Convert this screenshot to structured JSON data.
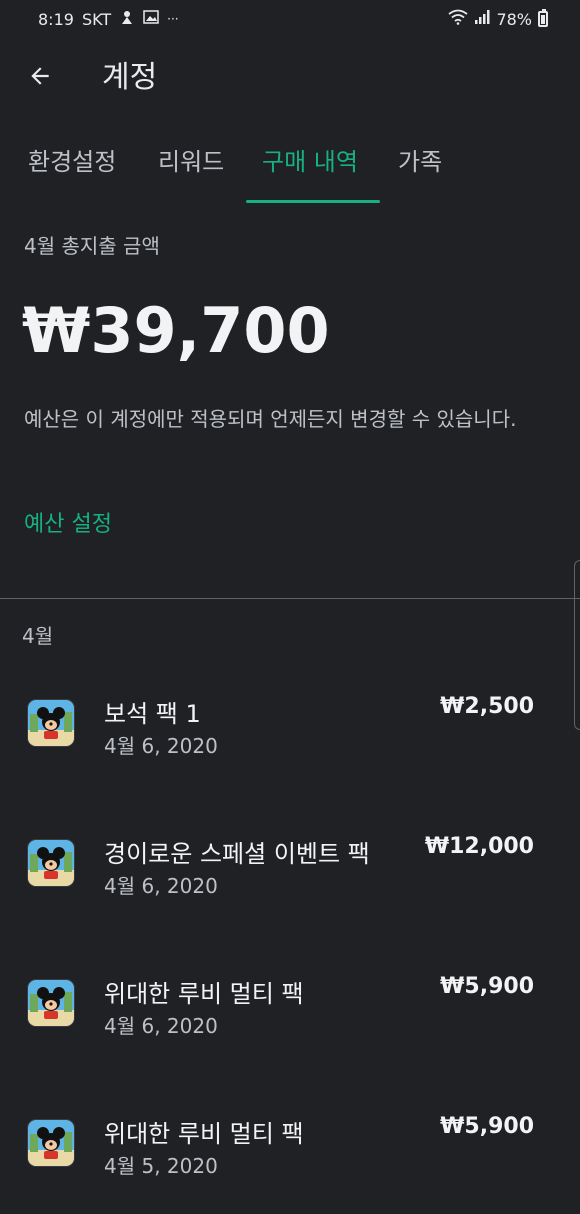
{
  "status_bar": {
    "time": "8:19",
    "carrier": "SKT",
    "more": "···",
    "battery": "78%",
    "battery_level": 0.78
  },
  "app_bar": {
    "title": "계정",
    "back_icon": "arrow-left-icon"
  },
  "tabs": [
    {
      "label": "환경설정",
      "active": false
    },
    {
      "label": "리워드",
      "active": false
    },
    {
      "label": "구매 내역",
      "active": true
    },
    {
      "label": "가족",
      "active": false
    }
  ],
  "summary": {
    "label": "4월 총지출 금액",
    "amount": "₩39,700",
    "description": "예산은 이 계정에만 적용되며 언제든지 변경할 수 있습니다.",
    "budget_link": "예산 설정"
  },
  "month_header": "4월",
  "purchases": [
    {
      "name": "보석 팩 1",
      "date": "4월 6, 2020",
      "price": "₩2,500"
    },
    {
      "name": "경이로운 스페셜 이벤트 팩",
      "date": "4월 6, 2020",
      "price": "₩12,000"
    },
    {
      "name": "위대한 루비 멀티 팩",
      "date": "4월 6, 2020",
      "price": "₩5,900"
    },
    {
      "name": "위대한 루비 멀티 팩",
      "date": "4월 5, 2020",
      "price": "₩5,900"
    }
  ],
  "colors": {
    "background": "#202124",
    "accent": "#17b080",
    "text_primary": "#f1f3f4",
    "text_secondary": "#bdc1c6"
  }
}
